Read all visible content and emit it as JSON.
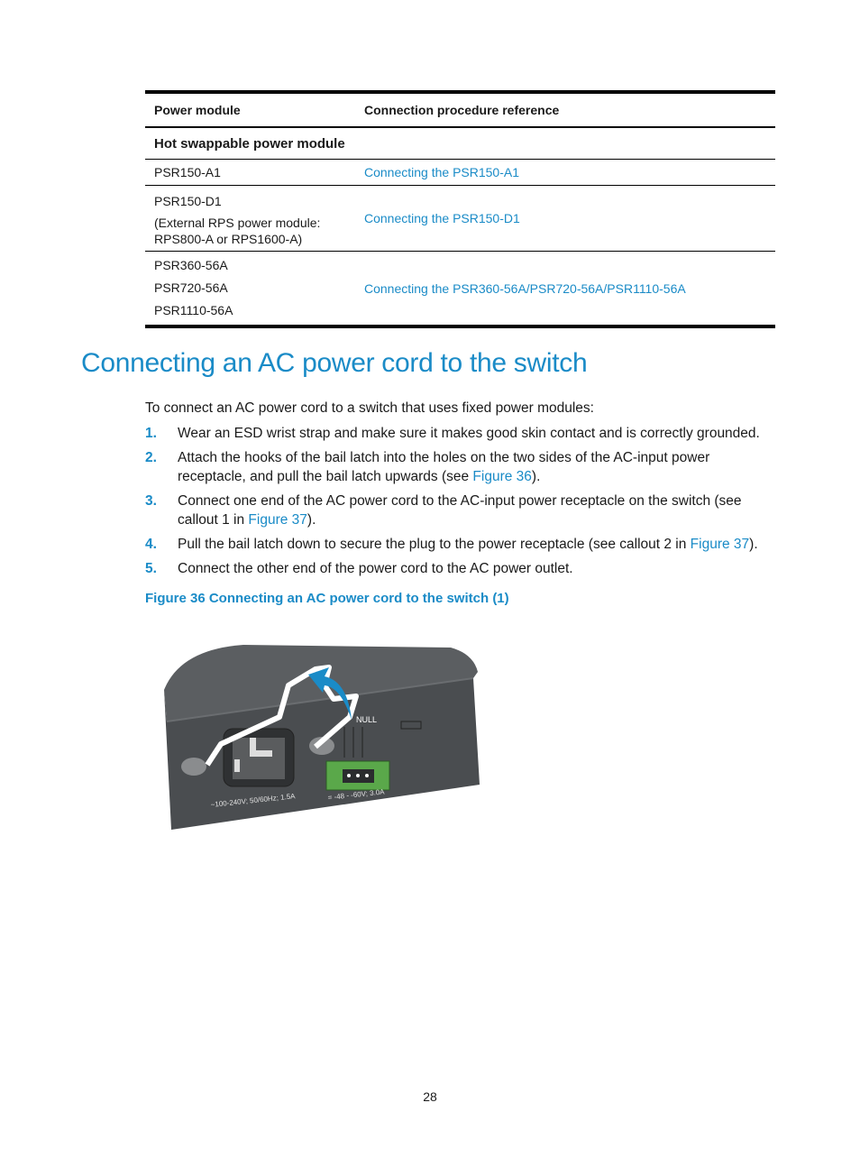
{
  "table": {
    "headers": [
      "Power module",
      "Connection procedure reference"
    ],
    "section": "Hot swappable power module",
    "rows": [
      {
        "modules": [
          "PSR150-A1"
        ],
        "reference": "Connecting the PSR150-A1"
      },
      {
        "modules": [
          "PSR150-D1"
        ],
        "note": "(External RPS power module: RPS800-A or RPS1600-A)",
        "reference": "Connecting the PSR150-D1"
      },
      {
        "modules": [
          "PSR360-56A",
          "PSR720-56A",
          "PSR1110-56A"
        ],
        "reference": "Connecting the PSR360-56A/PSR720-56A/PSR1110-56A"
      }
    ]
  },
  "heading": "Connecting an AC power cord to the switch",
  "intro": "To connect an AC power cord to a switch that uses fixed power modules:",
  "steps": [
    {
      "num": "1.",
      "text": "Wear an ESD wrist strap and make sure it makes good skin contact and is correctly grounded."
    },
    {
      "num": "2.",
      "text_before": "Attach the hooks of the bail latch into the holes on the two sides of the AC-input power receptacle, and pull the bail latch upwards (see ",
      "link": "Figure 36",
      "text_after": ")."
    },
    {
      "num": "3.",
      "text_before": "Connect one end of the AC power cord to the AC-input power receptacle on the switch (see callout 1 in ",
      "link": "Figure 37",
      "text_after": ")."
    },
    {
      "num": "4.",
      "text_before": "Pull the bail latch down to secure the plug to the power receptacle (see callout 2 in ",
      "link": "Figure 37",
      "text_after": ")."
    },
    {
      "num": "5.",
      "text": "Connect the other end of the power cord to the AC power outlet."
    }
  ],
  "figure": {
    "caption": "Figure 36 Connecting an AC power cord to the switch (1)",
    "ac_label": "~100-240V; 50/60Hz; 1.5A",
    "dc_label": "= -48 - -60V; 3.0A",
    "null_label": "NULL"
  },
  "colors": {
    "accent": "#1a8bc7",
    "chassis": "#4a4d50",
    "connector_green": "#5aa84a"
  },
  "page_number": "28"
}
